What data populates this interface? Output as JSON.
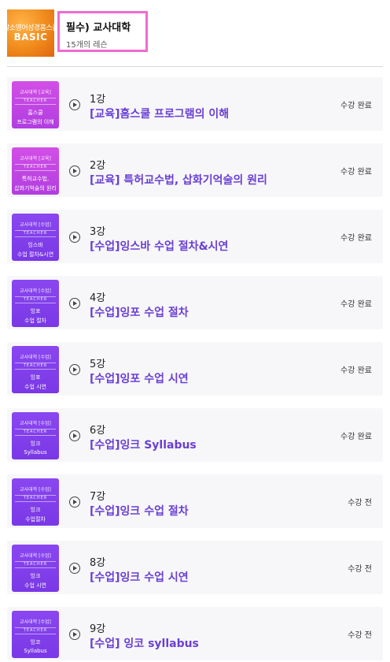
{
  "course": {
    "thumb_top_text": "말소영어성경홈스쿨",
    "thumb_label": "BASIC",
    "title": "필수) 교사대학",
    "lesson_count": "15개의 레슨"
  },
  "thumb_common": {
    "badge_word": "TEACHER"
  },
  "lessons": [
    {
      "thumb_variant": "edu",
      "category": "교사대학 [교육]",
      "line1": "홈스쿨",
      "line2": "프로그램의 이해",
      "number": "1강",
      "name": "[교육]홈스쿨 프로그램의 이해",
      "status": "수강 완료"
    },
    {
      "thumb_variant": "edu",
      "category": "교사대학 [교육]",
      "line1": "특허교수법,",
      "line2": "삽화기억술의 원리",
      "number": "2강",
      "name": "[교육] 특허교수법, 삽화기억술의 원리",
      "status": "수강 완료"
    },
    {
      "thumb_variant": "cls",
      "category": "교사대학 [수업]",
      "line1": "잉스바",
      "line2": "수업 절차&시연",
      "number": "3강",
      "name": "[수업]잉스바 수업 절차&시연",
      "status": "수강 완료"
    },
    {
      "thumb_variant": "cls",
      "category": "교사대학 [수업]",
      "line1": "잉포",
      "line2": "수업 절차",
      "number": "4강",
      "name": "[수업]잉포 수업 절차",
      "status": "수강 완료"
    },
    {
      "thumb_variant": "cls",
      "category": "교사대학 [수업]",
      "line1": "잉포",
      "line2": "수업 시연",
      "number": "5강",
      "name": "[수업]잉포 수업 시연",
      "status": "수강 완료"
    },
    {
      "thumb_variant": "cls",
      "category": "교사대학 [수업]",
      "line1": "잉크",
      "line2": "Syllabus",
      "number": "6강",
      "name": "[수업]잉크 Syllabus",
      "status": "수강 완료"
    },
    {
      "thumb_variant": "cls",
      "category": "교사대학 [수업]",
      "line1": "잉크",
      "line2": "수업절차",
      "number": "7강",
      "name": "[수업]잉크 수업 절차",
      "status": "수강 전"
    },
    {
      "thumb_variant": "cls",
      "category": "교사대학 [수업]",
      "line1": "잉크",
      "line2": "수업 시연",
      "number": "8강",
      "name": "[수업]잉크 수업 시연",
      "status": "수강 전"
    },
    {
      "thumb_variant": "cls",
      "category": "교사대학 [수업]",
      "line1": "잉코",
      "line2": "Syllabus",
      "number": "9강",
      "name": "[수업] 잉코 syllabus",
      "status": "수강 전"
    }
  ]
}
